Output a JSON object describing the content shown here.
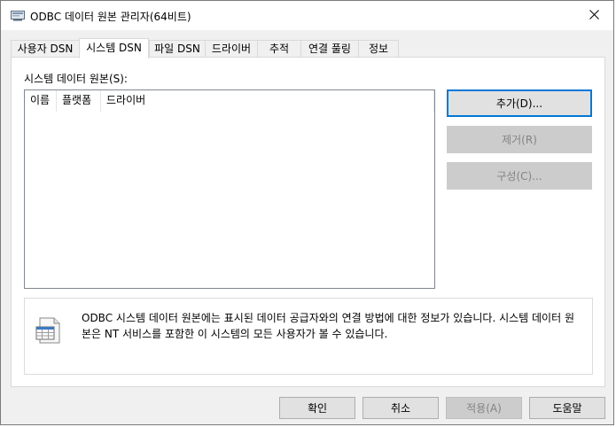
{
  "window": {
    "title": "ODBC 데이터 원본 관리자(64비트)"
  },
  "tabs": [
    {
      "label": "사용자 DSN",
      "selected": false
    },
    {
      "label": "시스템 DSN",
      "selected": true
    },
    {
      "label": "파일 DSN",
      "selected": false
    },
    {
      "label": "드라이버",
      "selected": false
    },
    {
      "label": "추적",
      "selected": false
    },
    {
      "label": "연결 풀링",
      "selected": false
    },
    {
      "label": "정보",
      "selected": false
    }
  ],
  "panel": {
    "section_label": "시스템 데이터 원본(S):",
    "columns": [
      "이름",
      "플랫폼",
      "드라이버"
    ],
    "buttons": {
      "add": "추가(D)...",
      "remove": "제거(R)",
      "configure": "구성(C)..."
    },
    "info_text": "ODBC 시스템 데이터 원본에는 표시된 데이터 공급자와의 연결 방법에 대한 정보가 있습니다. 시스템 데이터 원본은 NT 서비스를 포함한 이 시스템의 모든 사용자가 볼 수 있습니다."
  },
  "footer": {
    "ok": "확인",
    "cancel": "취소",
    "apply": "적용(A)",
    "help": "도움말"
  },
  "colors": {
    "accent": "#0078d7",
    "disabled_text": "#838383"
  }
}
